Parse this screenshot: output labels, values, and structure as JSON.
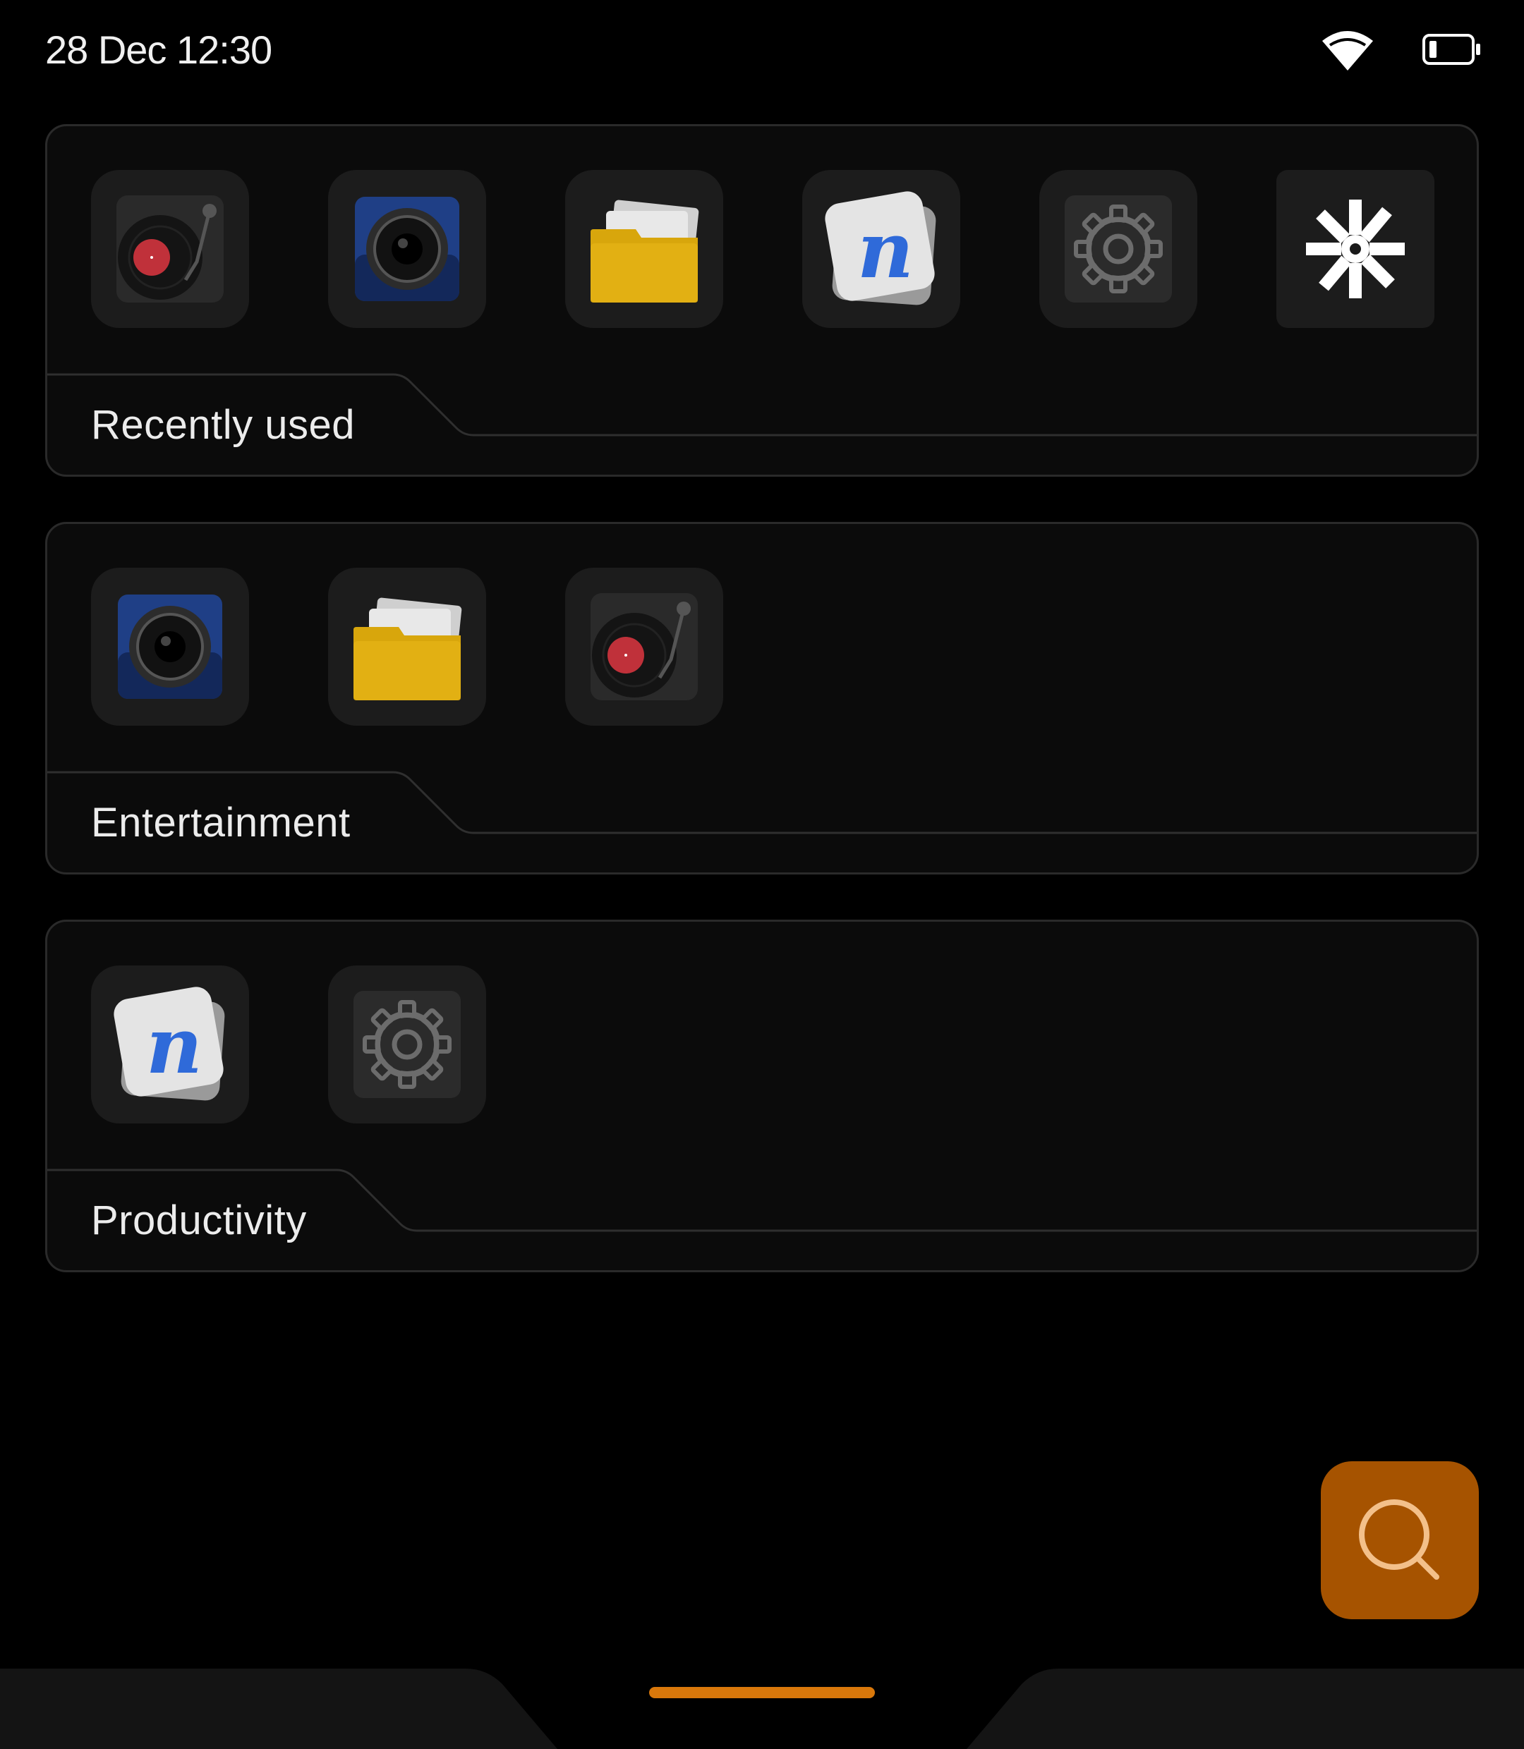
{
  "status_bar": {
    "datetime": "28 Dec  12:30",
    "icons": [
      "wifi-icon",
      "battery-icon"
    ]
  },
  "folders": [
    {
      "label": "Recently used",
      "apps": [
        "turntable-music-app-icon",
        "camera-app-icon",
        "files-app-icon",
        "notes-app-icon",
        "settings-app-icon",
        "sparkle-app-icon"
      ]
    },
    {
      "label": "Entertainment",
      "apps": [
        "camera-app-icon",
        "files-app-icon",
        "turntable-music-app-icon"
      ]
    },
    {
      "label": "Productivity",
      "apps": [
        "notes-app-icon",
        "settings-app-icon"
      ]
    }
  ],
  "search_button": {
    "icon": "search-icon"
  },
  "colors": {
    "accent": "#d9780b",
    "search_fab": "#a65300",
    "folder_bg": "#0b0b0b",
    "folder_border": "#2a2a2a",
    "app_tile": "#1c1c1c"
  }
}
